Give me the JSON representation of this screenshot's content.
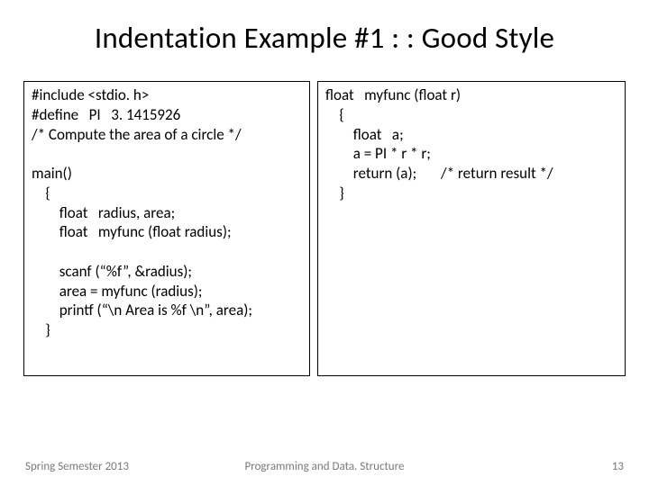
{
  "title": "Indentation Example #1 : : Good Style",
  "code_left": "#include <stdio. h>\n#define   PI   3. 1415926\n/* Compute the area of a circle */\n\nmain()\n    {\n        float   radius, area;\n        float   myfunc (float radius);\n\n        scanf (“%f”, &radius);\n        area = myfunc (radius);\n        printf (“\\n Area is %f \\n”, area);\n    }",
  "code_right": "float   myfunc (float r)\n    {\n        float   a;\n        a = PI * r * r;\n        return (a);       /* return result */\n    }",
  "footer": {
    "left": "Spring Semester 2013",
    "center": "Programming and Data. Structure",
    "page": "13"
  }
}
